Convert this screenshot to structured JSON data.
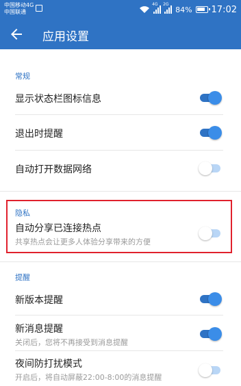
{
  "status_bar": {
    "carrier_line1": "中国移动4G",
    "carrier_line2": "中国联通",
    "network1": "4G",
    "network2": "2G",
    "battery": "84%",
    "time": "17:02"
  },
  "app_bar": {
    "title": "应用设置"
  },
  "sections": {
    "general": {
      "title": "常规",
      "items": [
        {
          "label": "显示状态栏图标信息",
          "enabled": true
        },
        {
          "label": "退出时提醒",
          "enabled": true
        },
        {
          "label": "自动打开数据网络",
          "enabled": false
        }
      ]
    },
    "privacy": {
      "title": "隐私",
      "items": [
        {
          "label": "自动分享已连接热点",
          "sub": "共享热点会让更多人体验分享带来的方便",
          "enabled": false
        }
      ]
    },
    "reminder": {
      "title": "提醒",
      "items": [
        {
          "label": "新版本提醒",
          "enabled": true
        },
        {
          "label": "新消息提醒",
          "sub": "关闭后，您将不再接受到消息提醒",
          "enabled": true
        },
        {
          "label": "夜间防打扰模式",
          "sub": "开启后，将自动屏蔽22:00-8:00的消息提醒",
          "enabled": false
        }
      ]
    }
  },
  "colors": {
    "accent": "#2f73c4",
    "highlight": "#e0202c"
  }
}
